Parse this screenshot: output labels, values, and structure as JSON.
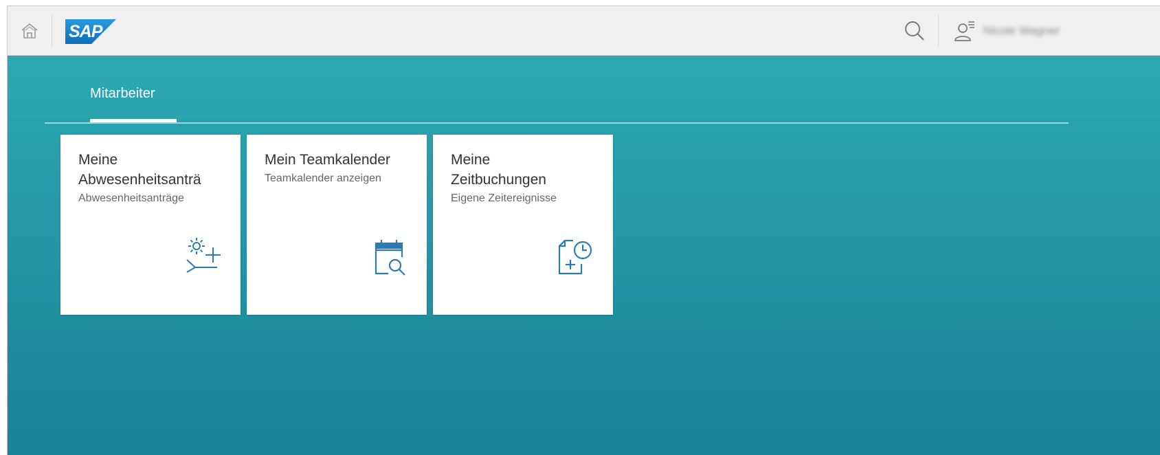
{
  "shell": {
    "logo_text": "SAP",
    "user_name": "Nicole Wagner",
    "home_icon": "home-icon",
    "search_icon": "search-icon",
    "user_icon": "user-settings-icon"
  },
  "tab": {
    "label": "Mitarbeiter"
  },
  "tiles": [
    {
      "title_line1": "Meine",
      "title_line2": "Abwesenheitsanträ",
      "subtitle": "Abwesenheitsanträge",
      "icon": "leave-request-icon"
    },
    {
      "title_line1": "Mein Teamkalender",
      "title_line2": "",
      "subtitle": "Teamkalender anzeigen",
      "icon": "calendar-search-icon"
    },
    {
      "title_line1": "Meine",
      "title_line2": "Zeitbuchungen",
      "subtitle": "Eigene Zeitereignisse",
      "icon": "time-entry-icon"
    }
  ],
  "colors": {
    "sap_blue": "#0f77bf",
    "icon_blue": "#2b7bb6",
    "background_top": "#2ca9b3",
    "background_bottom": "#19839a"
  }
}
